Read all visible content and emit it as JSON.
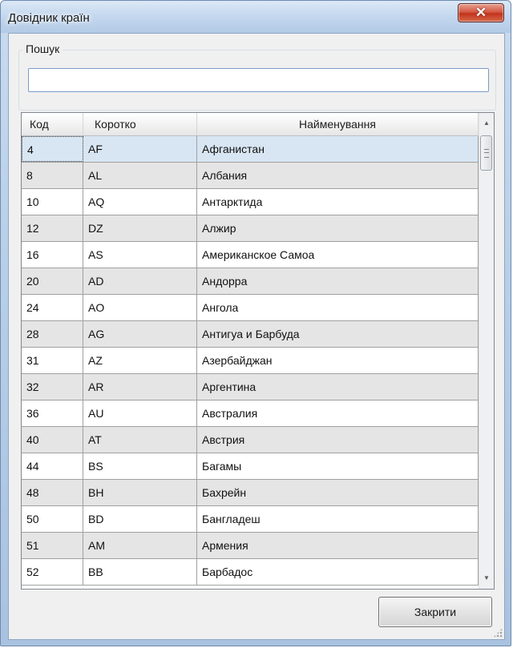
{
  "window": {
    "title": "Довідник країн",
    "close_glyph": "✕",
    "close_icon": "close-icon"
  },
  "search": {
    "group_label": "Пошук",
    "value": "",
    "placeholder": ""
  },
  "grid": {
    "columns": [
      "Код",
      "Коротко",
      "Найменування"
    ],
    "selected_row": 0,
    "rows": [
      {
        "code": "4",
        "short": "AF",
        "name": "Афганистан"
      },
      {
        "code": "8",
        "short": "AL",
        "name": "Албания"
      },
      {
        "code": "10",
        "short": "AQ",
        "name": "Антарктида"
      },
      {
        "code": "12",
        "short": "DZ",
        "name": "Алжир"
      },
      {
        "code": "16",
        "short": "AS",
        "name": "Американское Самоа"
      },
      {
        "code": "20",
        "short": "AD",
        "name": "Андорра"
      },
      {
        "code": "24",
        "short": "AO",
        "name": "Ангола"
      },
      {
        "code": "28",
        "short": "AG",
        "name": "Антигуа и Барбуда"
      },
      {
        "code": "31",
        "short": "AZ",
        "name": "Азербайджан"
      },
      {
        "code": "32",
        "short": "AR",
        "name": "Аргентина"
      },
      {
        "code": "36",
        "short": "AU",
        "name": "Австралия"
      },
      {
        "code": "40",
        "short": "AT",
        "name": "Австрия"
      },
      {
        "code": "44",
        "short": "BS",
        "name": "Багамы"
      },
      {
        "code": "48",
        "short": "BH",
        "name": "Бахрейн"
      },
      {
        "code": "50",
        "short": "BD",
        "name": "Бангладеш"
      },
      {
        "code": "51",
        "short": "AM",
        "name": "Армения"
      },
      {
        "code": "52",
        "short": "BB",
        "name": "Барбадос"
      }
    ],
    "scroll_up_glyph": "▲",
    "scroll_down_glyph": "▼"
  },
  "footer": {
    "close_label": "Закрити"
  },
  "colors": {
    "selected_row": "#d8e6f3",
    "alt_row": "#e5e5e5",
    "close_button_red": "#c2331c"
  }
}
